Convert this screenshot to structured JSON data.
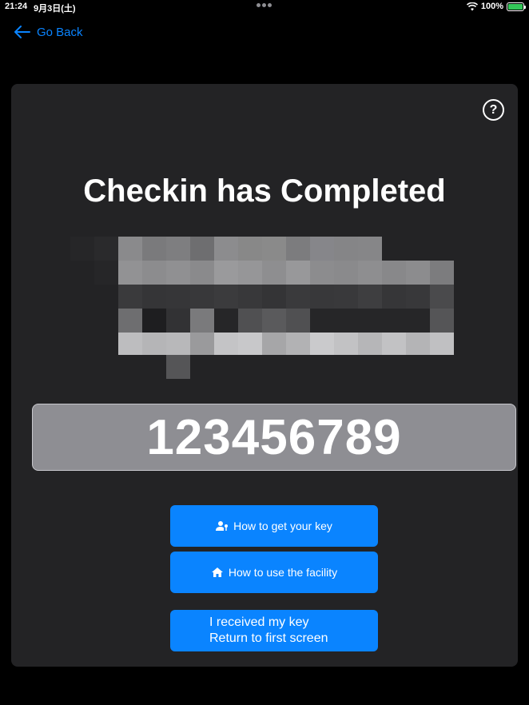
{
  "status_bar": {
    "time": "21:24",
    "date": "9月3日(土)",
    "battery": "100%"
  },
  "nav": {
    "back_label": "Go Back"
  },
  "card": {
    "help_label": "?",
    "title": "Checkin has Completed",
    "code": "123456789"
  },
  "buttons": {
    "get_key": "How to get your key",
    "use_facility": "How to use the facility",
    "received_line1": "I received my key",
    "received_line2": "Return to first screen"
  },
  "colors": {
    "accent": "#0a84ff",
    "card_bg": "#232325",
    "code_bg": "#8e8e93"
  },
  "icons": {
    "back": "arrow-left-icon",
    "help": "question-circle-icon",
    "get_key": "person-key-icon",
    "use_facility": "house-icon",
    "wifi": "wifi-icon",
    "battery": "battery-charging-icon"
  }
}
